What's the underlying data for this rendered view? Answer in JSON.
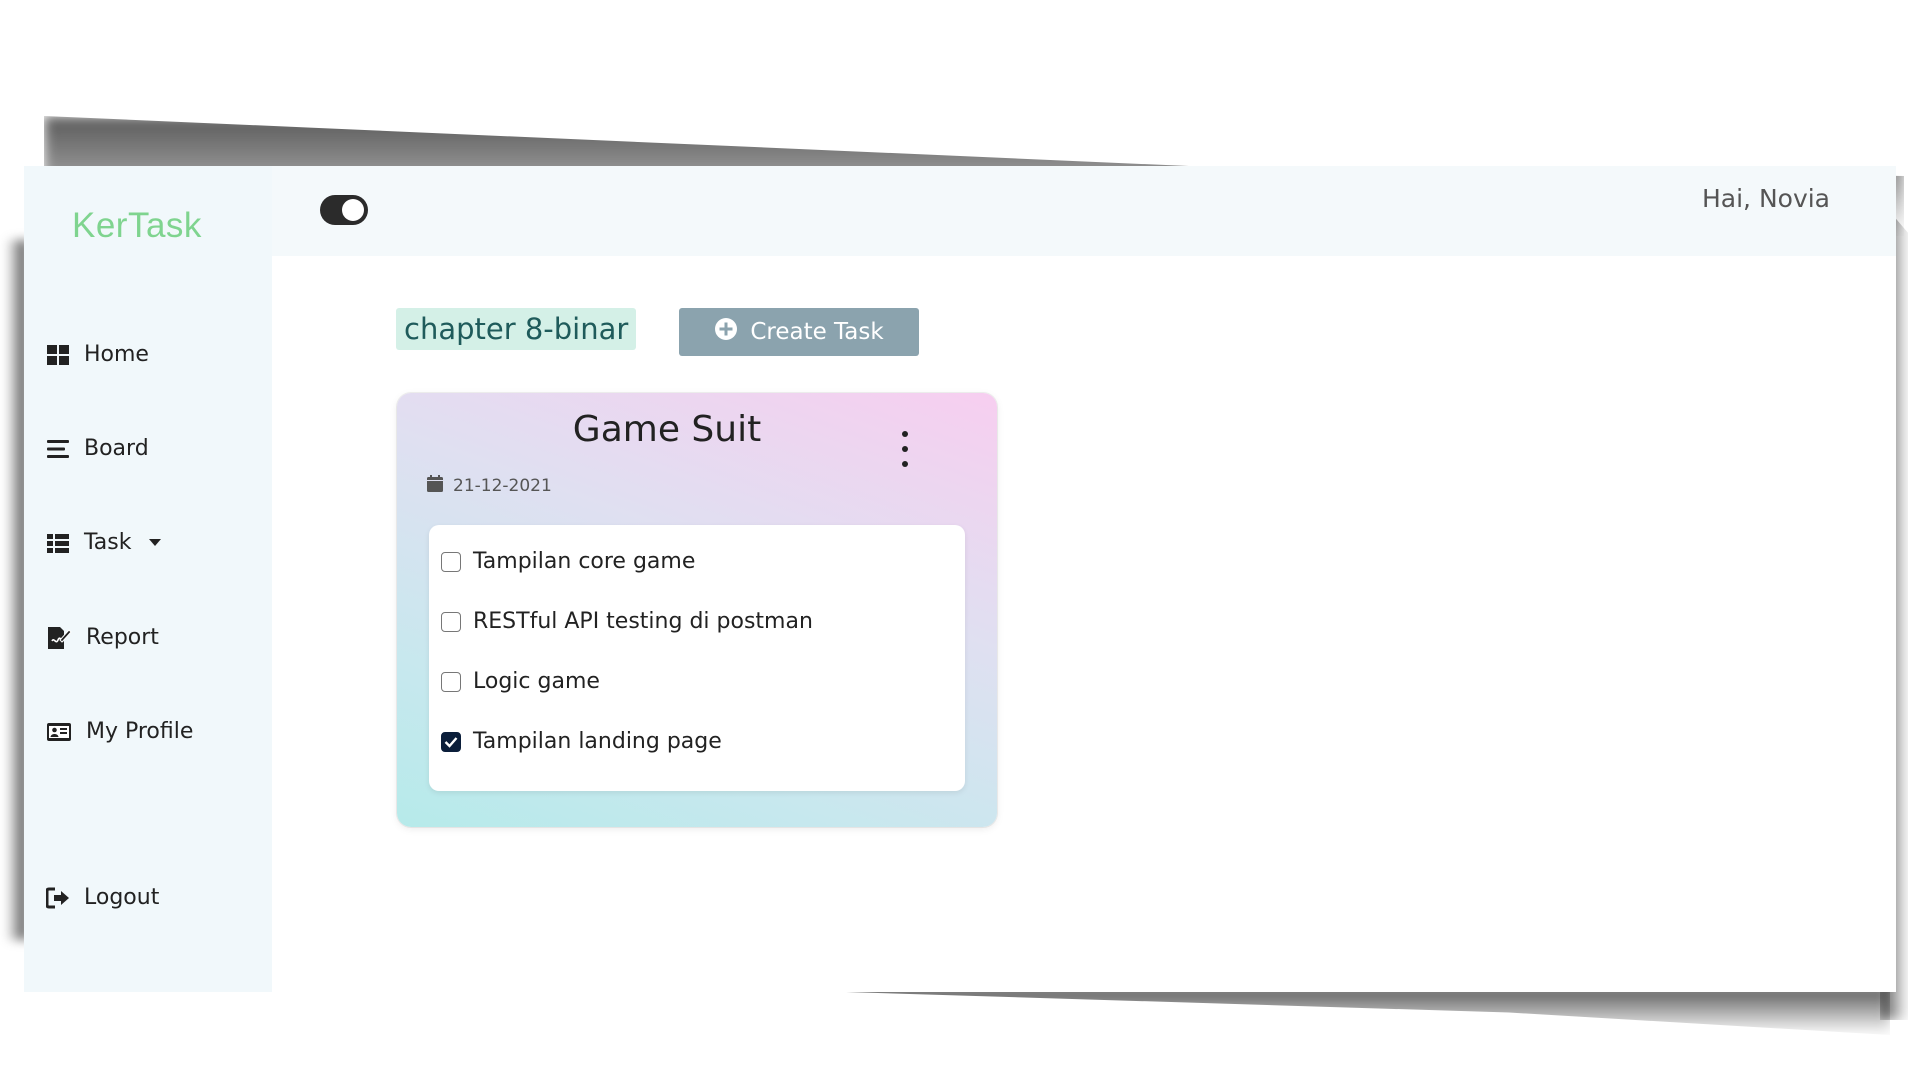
{
  "app": {
    "brand": "KerTask",
    "greeting": "Hai, Novia",
    "theme_toggle_on": true
  },
  "sidebar": {
    "items": [
      {
        "label": "Home",
        "icon": "grid-icon"
      },
      {
        "label": "Board",
        "icon": "bars-icon"
      },
      {
        "label": "Task",
        "icon": "list-icon",
        "has_dropdown": true
      },
      {
        "label": "Report",
        "icon": "file-signature-icon"
      },
      {
        "label": "My Profile",
        "icon": "id-card-icon"
      }
    ],
    "logout": {
      "label": "Logout",
      "icon": "sign-out-icon"
    }
  },
  "main": {
    "project_name": "chapter 8-binar",
    "create_button": {
      "label": "Create Task",
      "icon": "plus-circle-icon"
    }
  },
  "card": {
    "title": "Game Suit",
    "date": "21-12-2021",
    "date_icon": "calendar-icon",
    "menu_icon": "ellipsis-vertical-icon",
    "todos": [
      {
        "label": "Tampilan core game",
        "checked": false
      },
      {
        "label": "RESTful API testing di postman",
        "checked": false
      },
      {
        "label": "Logic game",
        "checked": false
      },
      {
        "label": "Tampilan landing page",
        "checked": true
      }
    ]
  },
  "colors": {
    "brand": "#7fd48f",
    "sidebar_bg": "#f1f8fb",
    "button": "#8ba3ae",
    "project_tag_bg": "#d4f0e7",
    "checkbox_checked": "#0b1e3a"
  }
}
